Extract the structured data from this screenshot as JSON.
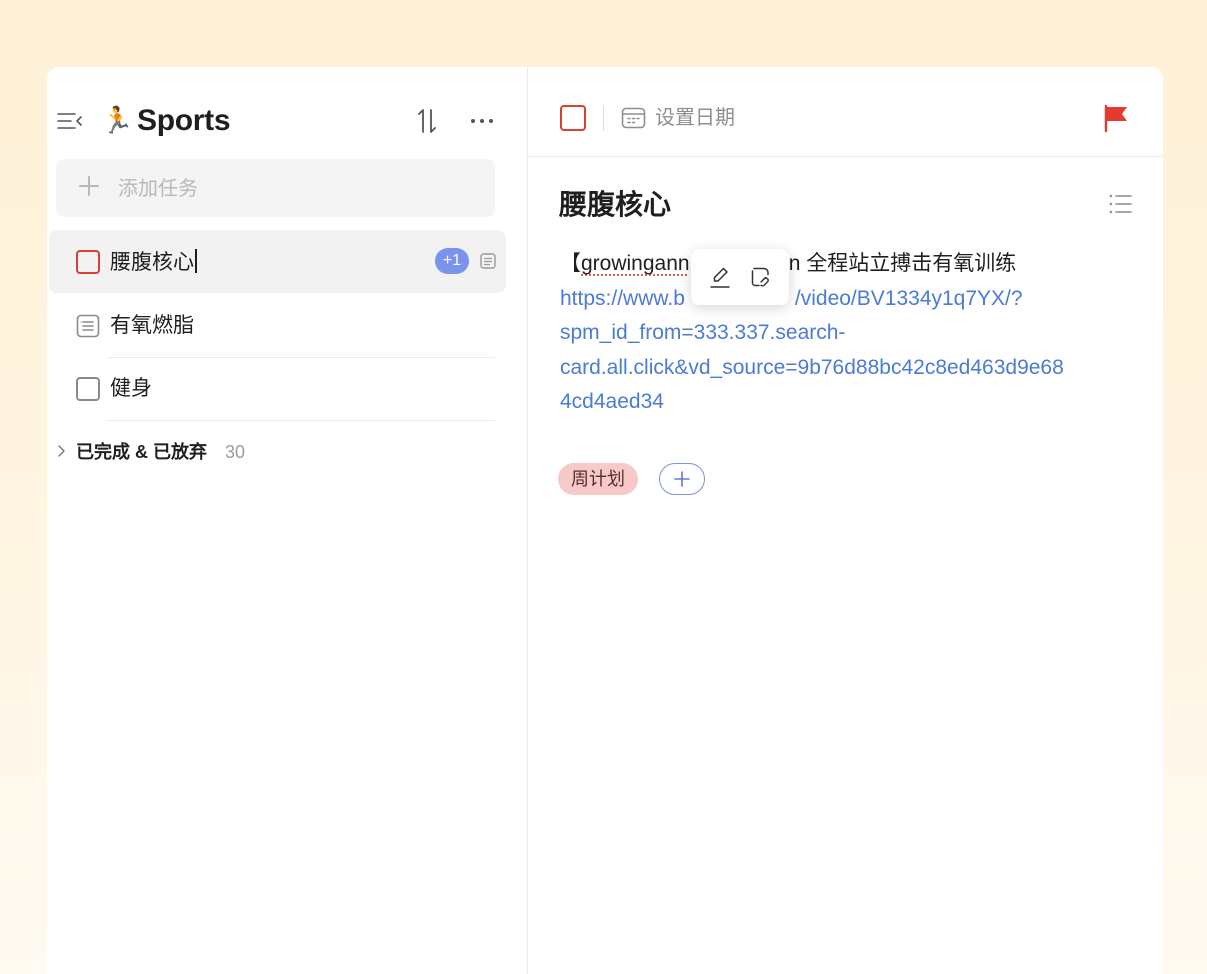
{
  "sidebar": {
    "list_emoji": "🏃",
    "list_title": "Sports",
    "add_task_placeholder": "添加任务",
    "tasks": [
      {
        "name": "腰腹核心",
        "badge": "+1",
        "checkbox": "red",
        "selected": true
      },
      {
        "name": "有氧燃脂",
        "checkbox": "note"
      },
      {
        "name": "健身",
        "checkbox": "grey"
      }
    ],
    "completed": {
      "label": "已完成 & 已放弃",
      "count": "30"
    }
  },
  "detail": {
    "date_label": "设置日期",
    "title": "腰腹核心",
    "desc_bracket": "【",
    "desc_visible_start": "growingann",
    "desc_visible_end": ")min 全程站立搏击有氧训练",
    "link": "https://www.b                /video/BV1334y1q7YX/?spm_id_from=333.337.search-card.all.click&vd_source=9b76d88bc42c8ed463d9e684cd4aed34",
    "link_line1": "https://www.b",
    "link_line1_end": "/video/BV1334y1q7YX/?",
    "link_line2": "spm_id_from=333.337.search-",
    "link_line3": "card.all.click&vd_source=9b76d88bc42c8ed463d9e68",
    "link_line4": "4cd4aed34",
    "tag": "周计划"
  },
  "colors": {
    "accent_red": "#d94032",
    "link_blue": "#4a7bd6",
    "badge_blue": "#7b93ef",
    "tag_pink": "#f7c9c9",
    "background": "#fff1d6"
  },
  "icons": [
    "menu-icon",
    "sort-icon",
    "more-icon",
    "plus-icon",
    "note-icon",
    "chevron-right-icon",
    "calendar-icon",
    "flag-icon",
    "list-icon",
    "edit-icon",
    "unlink-icon"
  ]
}
